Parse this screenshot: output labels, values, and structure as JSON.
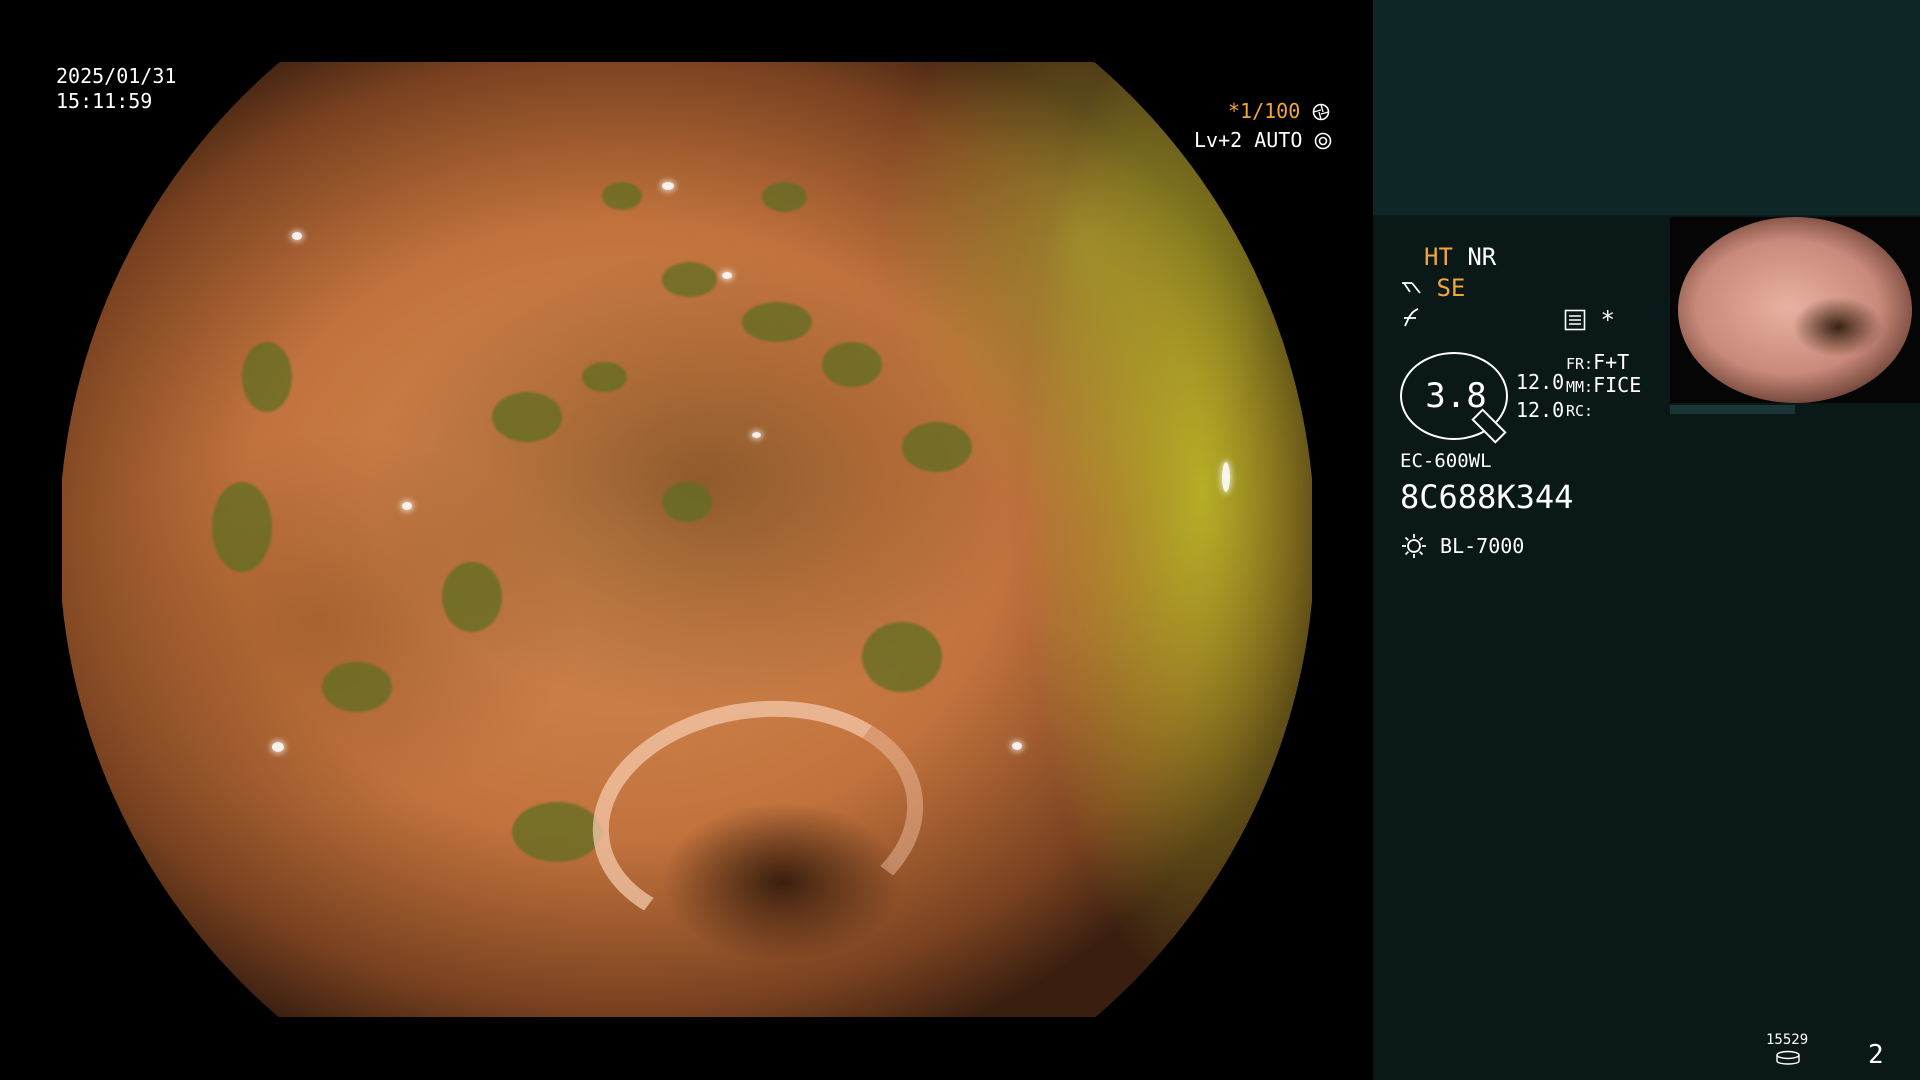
{
  "overlay": {
    "date": "2025/01/31",
    "time": "15:11:59",
    "shutter": "*1/100",
    "shutter_icon": "aperture-icon",
    "light_level": "Lv+2 AUTO",
    "light_icon": "iris-icon"
  },
  "panel": {
    "ht_label": "HT",
    "nr_label": "NR",
    "se_label": "SE",
    "mode_icon": "settings-list-icon",
    "mode_star": "*",
    "zoom_value": "3.8",
    "val_fr": "12.0",
    "val_mm": "12.0",
    "fr_label": "FR:",
    "fr_value": "F+T",
    "mm_label": "MM:",
    "mm_value": "FICE",
    "rc_label": "RC:",
    "scope_model": "EC-600WL",
    "serial": "8C688K344",
    "light_source": "BL-7000",
    "counter": "15529",
    "page_number": "2"
  },
  "colors": {
    "accent_orange": "#f0a63a",
    "panel_bg": "#0b1818",
    "panel_top_bg": "#0f2626"
  }
}
